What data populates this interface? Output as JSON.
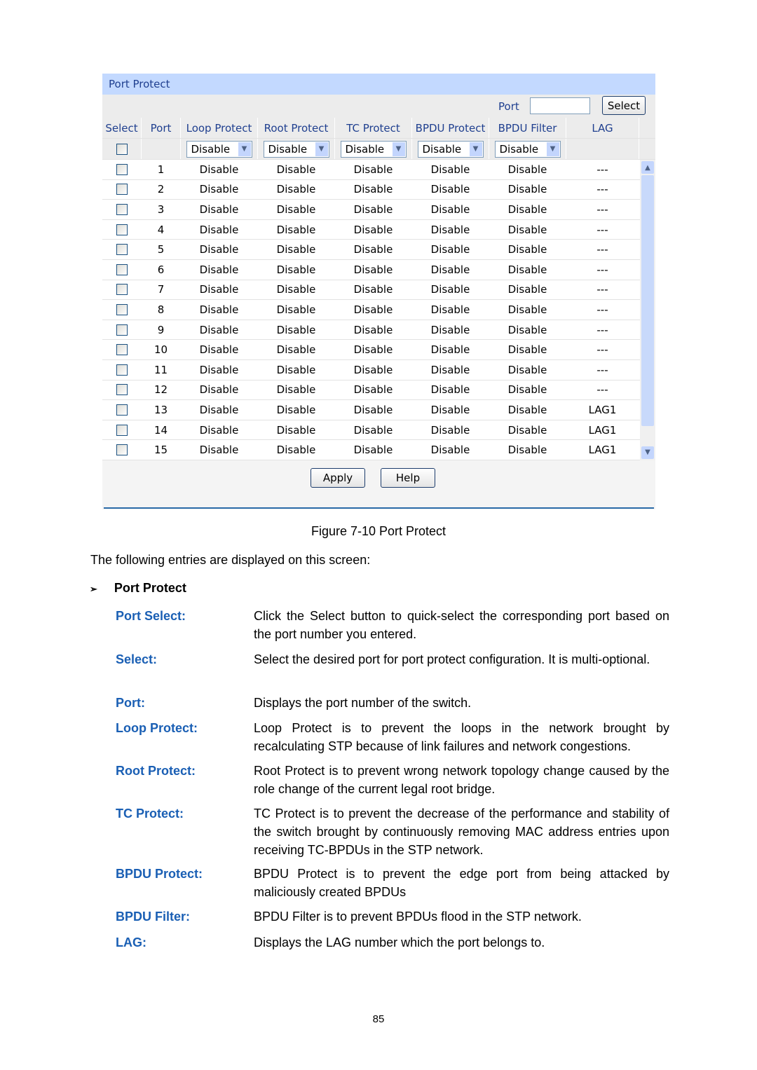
{
  "ui": {
    "title": "Port Protect",
    "port_label": "Port",
    "port_value": "",
    "select_button": "Select",
    "columns": [
      "Select",
      "Port",
      "Loop Protect",
      "Root Protect",
      "TC Protect",
      "BPDU Protect",
      "BPDU Filter",
      "LAG"
    ],
    "dropdown_value": "Disable",
    "rows": [
      {
        "port": "1",
        "v": "Disable",
        "lag": "---"
      },
      {
        "port": "2",
        "v": "Disable",
        "lag": "---"
      },
      {
        "port": "3",
        "v": "Disable",
        "lag": "---"
      },
      {
        "port": "4",
        "v": "Disable",
        "lag": "---"
      },
      {
        "port": "5",
        "v": "Disable",
        "lag": "---"
      },
      {
        "port": "6",
        "v": "Disable",
        "lag": "---"
      },
      {
        "port": "7",
        "v": "Disable",
        "lag": "---"
      },
      {
        "port": "8",
        "v": "Disable",
        "lag": "---"
      },
      {
        "port": "9",
        "v": "Disable",
        "lag": "---"
      },
      {
        "port": "10",
        "v": "Disable",
        "lag": "---"
      },
      {
        "port": "11",
        "v": "Disable",
        "lag": "---"
      },
      {
        "port": "12",
        "v": "Disable",
        "lag": "---"
      },
      {
        "port": "13",
        "v": "Disable",
        "lag": "LAG1"
      },
      {
        "port": "14",
        "v": "Disable",
        "lag": "LAG1"
      },
      {
        "port": "15",
        "v": "Disable",
        "lag": "LAG1"
      }
    ],
    "apply_button": "Apply",
    "help_button": "Help",
    "colors": {
      "header": "#c3d9ff",
      "text": "#1f3f8f"
    }
  },
  "caption": "Figure 7-10 Port Protect",
  "intro": "The following entries are displayed on this screen:",
  "section": "Port Protect",
  "definitions": [
    {
      "term": "Port Select:",
      "desc": "Click the Select button to quick-select the corresponding port based on the port number you entered."
    },
    {
      "term": "Select:",
      "desc": "Select the desired port for port protect configuration. It is multi-optional."
    },
    {
      "term": "Port:",
      "desc": "Displays the port number of the switch."
    },
    {
      "term": "Loop Protect:",
      "desc": "Loop Protect is to prevent the loops in the network brought by recalculating STP because of link failures and network congestions."
    },
    {
      "term": "Root Protect:",
      "desc": "Root Protect is to prevent wrong network topology change caused by the role change of the current legal root bridge."
    },
    {
      "term": "TC Protect:",
      "desc": "TC Protect is to prevent the decrease of the performance and stability of the switch brought by continuously removing MAC address entries upon receiving TC-BPDUs in the STP network."
    },
    {
      "term": "BPDU Protect:",
      "desc": "BPDU Protect is to prevent the edge port from being attacked by maliciously created BPDUs"
    },
    {
      "term": "BPDU Filter:",
      "desc": "BPDU Filter is to prevent BPDUs flood in the STP network."
    },
    {
      "term": "LAG:",
      "desc": "Displays the LAG number which the port belongs to."
    }
  ],
  "page_number": "85"
}
